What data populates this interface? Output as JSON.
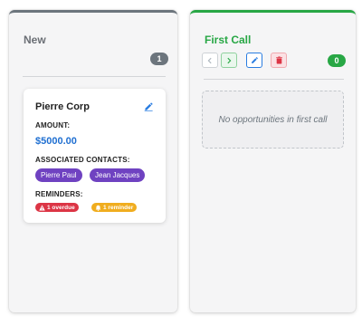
{
  "columns": [
    {
      "title": "New",
      "count": "1",
      "accent": "#6c757d",
      "card": {
        "name": "Pierre Corp",
        "amount_label": "AMOUNT:",
        "amount": "$5000.00",
        "contacts_label": "ASSOCIATED CONTACTS:",
        "contacts": [
          "Pierre Paul",
          "Jean Jacques"
        ],
        "reminders_label": "REMINDERS:",
        "reminders": [
          {
            "text": "1 overdue",
            "icon": "warning-icon",
            "color": "#dc3545"
          },
          {
            "text": "1 reminder",
            "icon": "bell-icon",
            "color": "#f0ad1f"
          }
        ]
      }
    },
    {
      "title": "First Call",
      "count": "0",
      "accent": "#28a745",
      "empty_text": "No opportunities in first call",
      "tools": [
        "chevron-left-icon",
        "chevron-right-icon",
        "edit-icon",
        "trash-icon"
      ]
    }
  ]
}
